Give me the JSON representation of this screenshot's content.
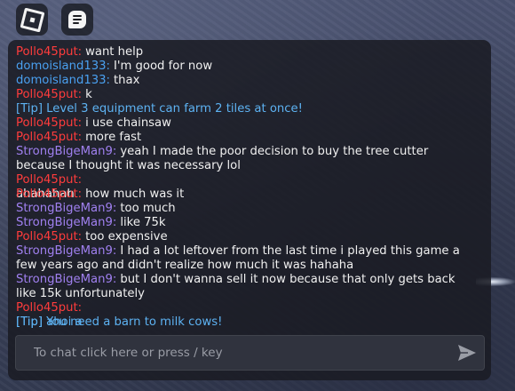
{
  "topbar": {
    "roblox_icon": "roblox-logo-icon",
    "chat_icon": "chat-bubble-icon"
  },
  "chat": {
    "messages": [
      {
        "type": "user",
        "name": "Pollo45put:",
        "text": "want help",
        "color": "#ff3c3c"
      },
      {
        "type": "user",
        "name": "domoisland133:",
        "text": "I'm good for now",
        "color": "#4aa0f0"
      },
      {
        "type": "user",
        "name": "domoisland133:",
        "text": "thax",
        "color": "#4aa0f0"
      },
      {
        "type": "user",
        "name": "Pollo45put:",
        "text": "k",
        "color": "#ff3c3c"
      },
      {
        "type": "tip",
        "text": "[Tip] Level 3 equipment can farm 2 tiles at once!"
      },
      {
        "type": "user",
        "name": "Pollo45put:",
        "text": "i use chainsaw",
        "color": "#ff3c3c"
      },
      {
        "type": "user",
        "name": "Pollo45put:",
        "text": "more fast",
        "color": "#ff3c3c"
      },
      {
        "type": "user",
        "name": "StrongBigeMan9:",
        "text": "yeah I made the poor decision to buy the tree cutter because I thought it was necessary lol",
        "color": "#a080f0"
      },
      {
        "type": "user",
        "name": "Pollo45put:",
        "text": "",
        "color": "#ff3c3c"
      },
      {
        "type": "overlap",
        "under_text": "ahahahah",
        "name": "Pollo45put:",
        "text": "how much was it",
        "color": "#ff3c3c"
      },
      {
        "type": "user",
        "name": "StrongBigeMan9:",
        "text": "too much",
        "color": "#a080f0"
      },
      {
        "type": "user",
        "name": "StrongBigeMan9:",
        "text": "like 75k",
        "color": "#a080f0"
      },
      {
        "type": "user",
        "name": "Pollo45put:",
        "text": "too expensive",
        "color": "#ff3c3c"
      },
      {
        "type": "user",
        "name": "StrongBigeMan9:",
        "text": "I had a lot leftover from the last time i played this game a few years ago and didn't realize how much it was hahaha",
        "color": "#a080f0"
      },
      {
        "type": "user",
        "name": "StrongBigeMan9:",
        "text": "but I don't wanna sell it now because that only gets back like 15k unfortunately",
        "color": "#a080f0"
      },
      {
        "type": "user",
        "name": "Pollo45put:",
        "text": "",
        "color": "#ff3c3c"
      },
      {
        "type": "overlap_tip",
        "under_text": "[Tip] ahoi a",
        "text": "[Tip] You need a barn to milk cows!"
      }
    ],
    "input": {
      "placeholder": "To chat click here or press / key",
      "value": ""
    },
    "send_icon": "send-arrow-icon"
  }
}
